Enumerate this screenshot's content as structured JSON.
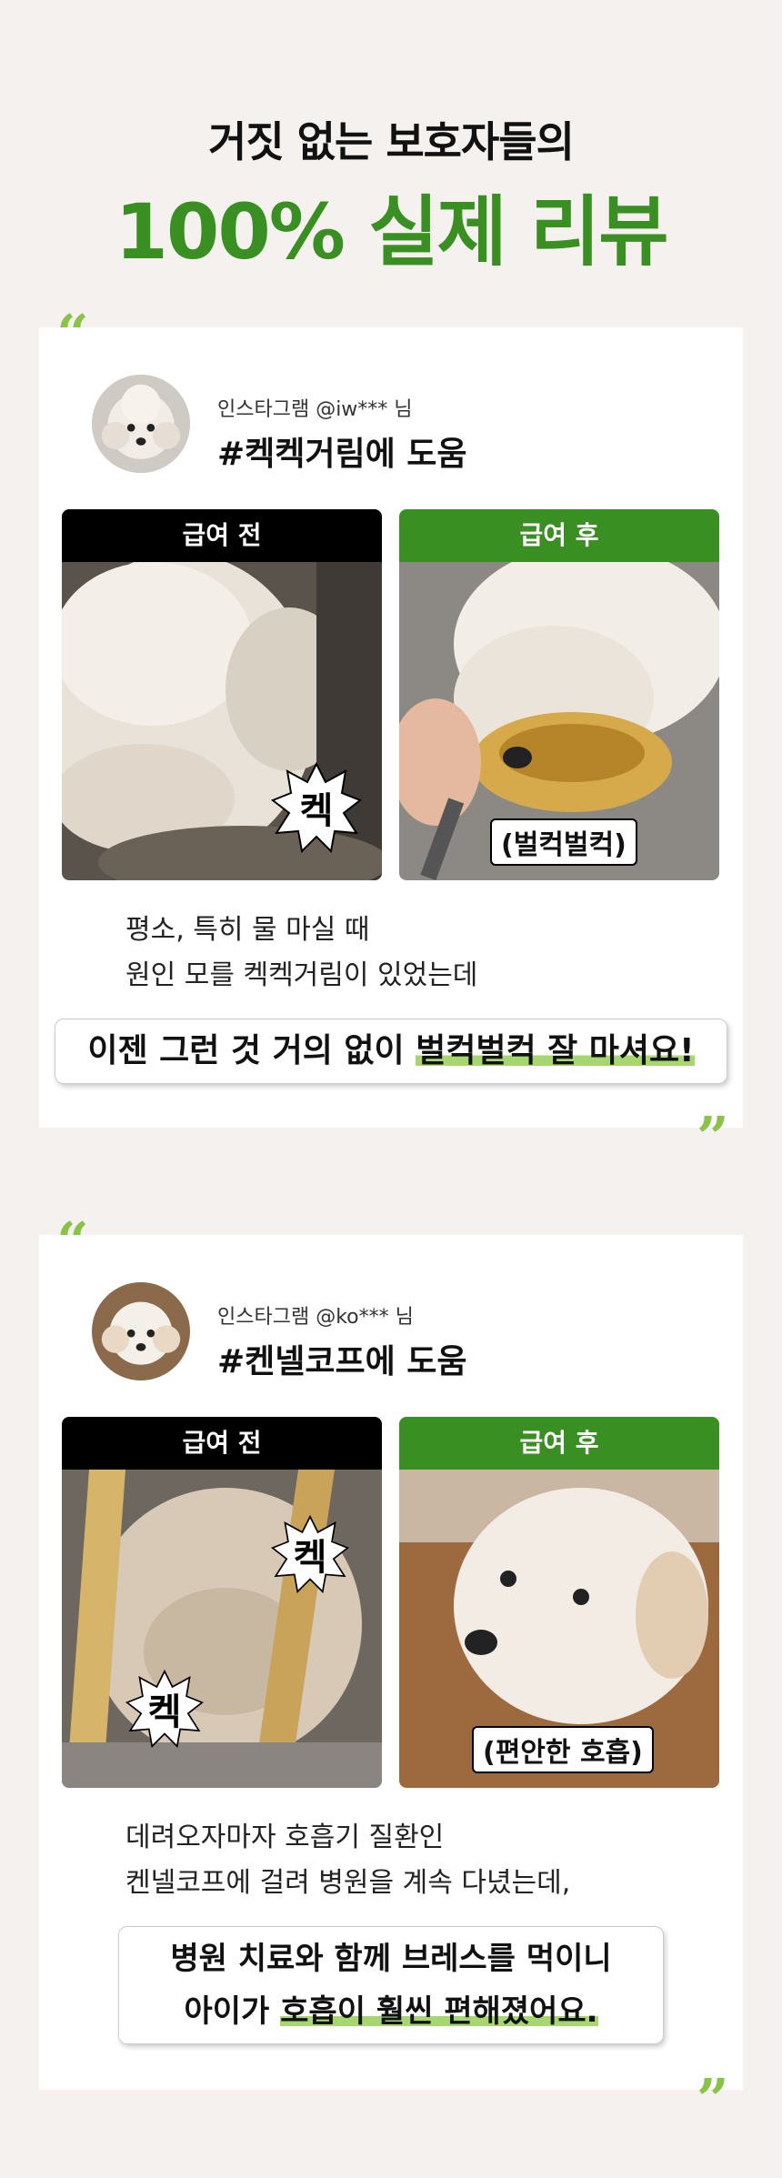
{
  "header": {
    "line1": "거짓 없는 보호자들의",
    "line2": "100% 실제 리뷰"
  },
  "quote_open": "“",
  "quote_close": "”",
  "colors": {
    "accent_green": "#3a8f22",
    "highlight_green": "#a5d66f",
    "quote_green": "#8bc34a"
  },
  "reviews": [
    {
      "handle": "인스타그램 @iw*** 님",
      "tag": "#켁켁거림에 도움",
      "before_label": "급여 전",
      "after_label": "급여 후",
      "before_bubbles": [
        "켁"
      ],
      "after_caption": "(벌컥벌컥)",
      "body_lines": [
        "평소, 특히 물 마실 때",
        "원인 모를 켁켁거림이 있었는데"
      ],
      "highlight_prefix": "이젠 그런 것 거의 없이 ",
      "highlight_marked": "벌컥벌컥 잘 마셔요!"
    },
    {
      "handle": "인스타그램 @ko*** 님",
      "tag": "#켄넬코프에 도움",
      "before_label": "급여 전",
      "after_label": "급여 후",
      "before_bubbles": [
        "켁",
        "켁"
      ],
      "after_caption": "(편안한 호흡)",
      "body_lines": [
        "데려오자마자 호흡기 질환인",
        "켄넬코프에 걸려 병원을 계속 다녔는데,"
      ],
      "highlight_line1": "병원 치료와 함께 브레스를 먹이니",
      "highlight_prefix": "아이가 ",
      "highlight_marked": "호흡이 훨씬 편해졌어요."
    }
  ]
}
